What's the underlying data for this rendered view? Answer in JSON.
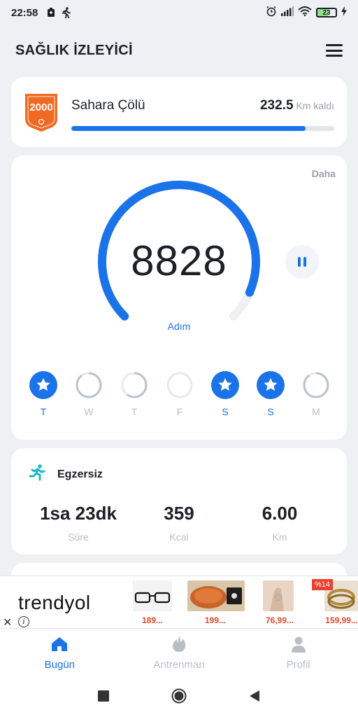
{
  "status_bar": {
    "time": "22:58",
    "battery_level": "23"
  },
  "header": {
    "title": "SAĞLIK İZLEYİCİ"
  },
  "challenge": {
    "badge_number": "2000",
    "name": "Sahara Çölü",
    "remaining_value": "232.5",
    "remaining_unit": "Km kaldı",
    "progress": 0.89
  },
  "steps": {
    "more_label": "Daha",
    "value": "8828",
    "label": "Adım",
    "gauge_progress": 0.92
  },
  "week": [
    {
      "label": "T",
      "status": "done"
    },
    {
      "label": "W",
      "status": "partial",
      "progress": 0.9
    },
    {
      "label": "T",
      "status": "partial",
      "progress": 0.6
    },
    {
      "label": "F",
      "status": "empty",
      "progress": 0.0
    },
    {
      "label": "S",
      "status": "done"
    },
    {
      "label": "S",
      "status": "done"
    },
    {
      "label": "M",
      "status": "partial",
      "progress": 0.9
    }
  ],
  "exercise": {
    "title": "Egzersiz",
    "icon": "running-icon",
    "metrics": [
      {
        "value": "1sa 23dk",
        "label": "Süre"
      },
      {
        "value": "359",
        "label": "Kcal"
      },
      {
        "value": "6.00",
        "label": "Km"
      }
    ]
  },
  "ad": {
    "brand": "trendyol",
    "discount": "%14",
    "products": [
      {
        "price": "189..."
      },
      {
        "price": "199..."
      },
      {
        "price": "76,99..."
      },
      {
        "price": "159,99..."
      }
    ]
  },
  "nav": {
    "tabs": [
      {
        "label": "Bugün",
        "icon": "home-icon",
        "active": true
      },
      {
        "label": "Antrenman",
        "icon": "flame-icon",
        "active": false
      },
      {
        "label": "Profil",
        "icon": "person-icon",
        "active": false
      }
    ]
  },
  "colors": {
    "accent": "#1a73e8",
    "badge_orange": "#f06a22",
    "muted": "#b9bec6"
  }
}
